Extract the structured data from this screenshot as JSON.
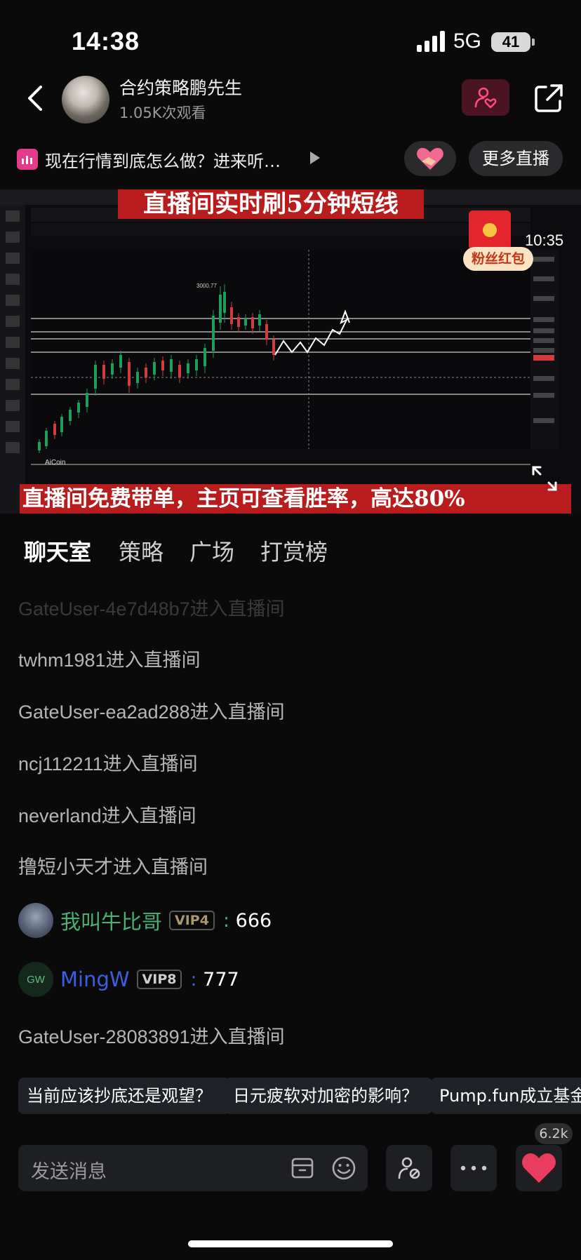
{
  "status_bar": {
    "time": "14:38",
    "network": "5G",
    "battery": "41"
  },
  "header": {
    "host_name": "合约策略鹏先生",
    "viewers": "1.05K次观看"
  },
  "topic": {
    "text": "现在行情到底怎么做？进来听…",
    "more_live_label": "更多直播"
  },
  "video": {
    "top_banner": "直播间实时刷5分钟短线",
    "bottom_banner": "直播间免费带单，主页可查看胜率，高达80%",
    "redpack_label": "粉丝红包",
    "countdown": "10:35",
    "chart_high_label": "3000.77",
    "chart_watermark": "AiCoin"
  },
  "tabs": [
    "聊天室",
    "策略",
    "广场",
    "打赏榜"
  ],
  "chat": {
    "faded_message": "GateUser-4e7d48b7进入直播间",
    "system_messages": [
      "twhm1981进入直播间",
      "GateUser-ea2ad288进入直播间",
      "ncj112211进入直播间",
      "neverland进入直播间",
      "撸短小天才进入直播间"
    ],
    "user_messages": [
      {
        "name": "我叫牛比哥",
        "vip": "VIP4",
        "text": "666",
        "name_color": "#4caf73"
      },
      {
        "name": "MingW",
        "vip": "VIP8",
        "text": "777",
        "name_color": "#3b5fe0",
        "avatar_text": "GW"
      }
    ],
    "last_message": "GateUser-28083891进入直播间"
  },
  "suggestions": [
    "当前应该抄底还是观望？",
    "日元疲软对加密的影响？",
    "Pump.fun成立基金，"
  ],
  "input": {
    "placeholder": "发送消息",
    "like_count": "6.2k"
  }
}
